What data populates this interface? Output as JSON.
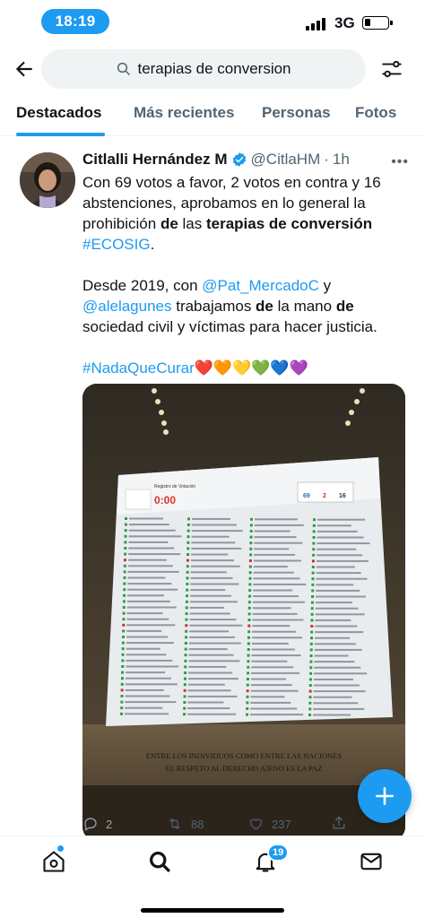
{
  "status_bar": {
    "time": "18:19",
    "network": "3G",
    "battery_level": 0.25
  },
  "search": {
    "query": "terapias de conversion"
  },
  "tabs": [
    {
      "label": "Destacados",
      "active": true
    },
    {
      "label": "Más recientes",
      "active": false
    },
    {
      "label": "Personas",
      "active": false
    },
    {
      "label": "Fotos",
      "active": false
    }
  ],
  "tweet": {
    "author_name": "Citlalli Hernández M",
    "handle": "@CitlaHM",
    "separator": "·",
    "time": "1h",
    "p1_a": "Con 69 votos a favor, 2 votos en contra y 16 abstenciones, aprobamos en lo general la prohibición ",
    "p1_b": "de",
    "p1_c": " las ",
    "p1_d": "terapias de conversión",
    "p1_e": "#ECOSIG",
    "p1_f": ".",
    "p2_a": "Desde 2019, con ",
    "p2_mention1": "@Pat_MercadoC",
    "p2_b": " y ",
    "p2_mention2": "@alelagunes",
    "p2_c": " trabajamos ",
    "p2_d": "de",
    "p2_e": " la mano ",
    "p2_f": "de",
    "p2_g": " sociedad civil y víctimas para hacer justicia.",
    "hashtag": "#NadaQueCurar",
    "hearts": "❤️🧡💛💚💙💜",
    "media": {
      "screen_title": "Registro de Votación",
      "timer": "0:00",
      "votes": [
        "69",
        "2",
        "16"
      ],
      "inscription_line1": "ENTRE LOS INDIVIDUOS COMO ENTRE LAS NACIONES",
      "inscription_line2": "EL RESPETO AL DERECHO AJENO ES LA PAZ"
    },
    "replies": "2",
    "retweets": "88",
    "likes": "237"
  },
  "bottom_nav": {
    "notifications_count": "19"
  },
  "colors": {
    "accent": "#1d9bf0",
    "secondary_text": "#536471",
    "text": "#0f1419"
  }
}
